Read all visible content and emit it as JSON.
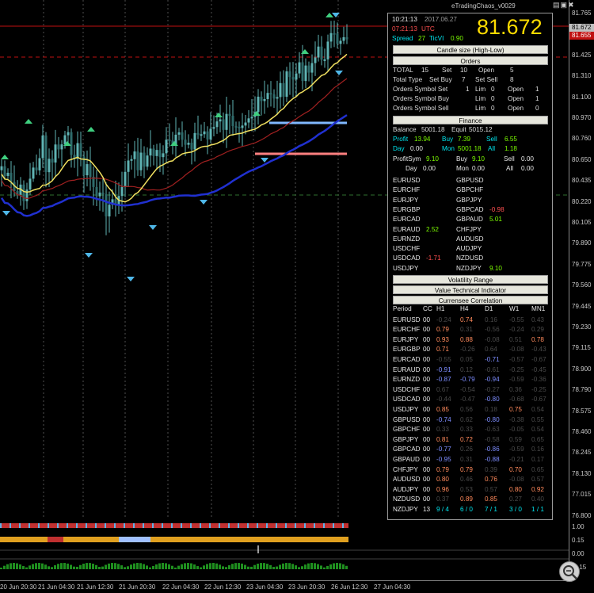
{
  "window": {
    "title": "eTradingChaos_v0029",
    "controls": "▤▣✖"
  },
  "price_axis": {
    "labels": [
      "81.765",
      "81.650",
      "81.425",
      "81.310",
      "81.100",
      "80.970",
      "80.760",
      "80.650",
      "80.435",
      "80.220",
      "80.105",
      "79.890",
      "79.775",
      "79.560",
      "79.445",
      "79.230",
      "79.115",
      "78.900",
      "78.790",
      "78.575",
      "78.460",
      "78.245",
      "78.130",
      "77.015",
      "76.800",
      "1.00",
      "0.15",
      "0.00",
      "-0.15"
    ],
    "current_bid": "81.672",
    "current_ask": "81.655"
  },
  "time_axis": {
    "labels": [
      "20 Jun 20:30",
      "21 Jun 04:30",
      "21 Jun 12:30",
      "21 Jun 20:30",
      "22 Jun 04:30",
      "22 Jun 12:30",
      "23 Jun 04:30",
      "23 Jun 20:30",
      "26 Jun 12:30",
      "27 Jun 04:30"
    ]
  },
  "panel": {
    "local_time": "10:21:13",
    "date": "2017.06.27",
    "utc_time": "07:21:13",
    "utc_label": "UTC",
    "spread_label": "Spread",
    "spread_value": "27",
    "ticvi_label": "TicVI",
    "ticvi_value": "0.90",
    "big_price": "81.672",
    "btn_candle": "Candle size (High-Low)",
    "btn_orders": "Orders",
    "btn_finance": "Finance",
    "btn_volatility": "Volatility Range",
    "btn_value_tech": "Value Technical Indicator",
    "btn_correlation": "Currensee Correlation",
    "orders": {
      "total_label": "TOTAL",
      "total": "15",
      "set_label": "Set",
      "set": "10",
      "open_label": "Open",
      "open": "5",
      "tt_label": "Total Type",
      "setbuy_label": "Set Buy",
      "setbuy": "7",
      "setsell_label": "Set Sell",
      "setsell": "8",
      "oss_label": "Orders Symbol Set",
      "oss_val": "1",
      "lim_label": "Lim",
      "oss_lim": "0",
      "oss_open": "1",
      "osb_label": "Orders Symbol Buy",
      "osb_lim": "0",
      "osb_open": "1",
      "osl_label": "Orders Symbol Sell",
      "osl_lim": "0",
      "osl_open": "0"
    },
    "finance": {
      "balance_label": "Balance",
      "balance": "5001.18",
      "equity_label": "Equit",
      "equity": "5015.12",
      "profit_label": "Profit",
      "profit": "13.94",
      "buy_label": "Buy",
      "buy": "7.39",
      "sell_label": "Sell",
      "sell": "6.55",
      "day_label": "Day",
      "day": "0.00",
      "mon_label": "Mon",
      "mon": "5001.18",
      "all_label": "All",
      "all": "1.18",
      "ps_label": "ProfitSym",
      "ps": "9.10",
      "ps_buy": "9.10",
      "ps_sell": "0.00",
      "ps_day": "0.00",
      "ps_mon": "0.00",
      "ps_all": "0.00"
    },
    "pairs": [
      [
        "EURUSD",
        ""
      ],
      [
        "GBPUSD",
        ""
      ],
      [
        "EURCHF",
        ""
      ],
      [
        "GBPCHF",
        ""
      ],
      [
        "EURJPY",
        ""
      ],
      [
        "GBPJPY",
        ""
      ],
      [
        "EURGBP",
        ""
      ],
      [
        "GBPCAD",
        "-0.98"
      ],
      [
        "EURCAD",
        ""
      ],
      [
        "GBPAUD",
        "5.01"
      ],
      [
        "EURAUD",
        "2.52"
      ],
      [
        "CHFJPY",
        ""
      ],
      [
        "EURNZD",
        ""
      ],
      [
        "AUDUSD",
        ""
      ],
      [
        "USDCHF",
        ""
      ],
      [
        "AUDJPY",
        ""
      ],
      [
        "USDCAD",
        "-1.71"
      ],
      [
        "NZDUSD",
        ""
      ],
      [
        "USDJPY",
        ""
      ],
      [
        "NZDJPY",
        "9.10"
      ]
    ],
    "corr_header": [
      "Period",
      "CC",
      "H1",
      "H4",
      "D1",
      "W1",
      "MN1"
    ],
    "corr_rows": [
      [
        "EURUSD",
        "00",
        "-0.24",
        "0.74",
        "0.16",
        "-0.55",
        "0.43"
      ],
      [
        "EURCHF",
        "00",
        "0.79",
        "0.31",
        "-0.56",
        "-0.24",
        "0.29"
      ],
      [
        "EURJPY",
        "00",
        "0.93",
        "0.88",
        "-0.08",
        "0.51",
        "0.78"
      ],
      [
        "EURGBP",
        "00",
        "0.71",
        "-0.26",
        "0.64",
        "-0.08",
        "-0.43"
      ],
      [
        "EURCAD",
        "00",
        "-0.55",
        "0.05",
        "-0.71",
        "-0.57",
        "-0.67"
      ],
      [
        "EURAUD",
        "00",
        "-0.91",
        "0.12",
        "-0.61",
        "-0.25",
        "-0.45"
      ],
      [
        "EURNZD",
        "00",
        "-0.87",
        "-0.79",
        "-0.94",
        "-0.59",
        "-0.36"
      ],
      [
        "USDCHF",
        "00",
        "0.67",
        "-0.54",
        "-0.27",
        "0.36",
        "-0.25"
      ],
      [
        "USDCAD",
        "00",
        "-0.44",
        "-0.47",
        "-0.80",
        "-0.68",
        "-0.67"
      ],
      [
        "USDJPY",
        "00",
        "0.85",
        "0.56",
        "0.18",
        "0.75",
        "0.54"
      ],
      [
        "GBPUSD",
        "00",
        "-0.74",
        "0.62",
        "-0.80",
        "-0.38",
        "0.55"
      ],
      [
        "GBPCHF",
        "00",
        "0.33",
        "0.33",
        "-0.63",
        "-0.05",
        "0.54"
      ],
      [
        "GBPJPY",
        "00",
        "0.81",
        "0.72",
        "-0.58",
        "0.59",
        "0.65"
      ],
      [
        "GBPCAD",
        "00",
        "-0.77",
        "0.26",
        "-0.86",
        "-0.59",
        "0.16"
      ],
      [
        "GBPAUD",
        "00",
        "-0.95",
        "0.31",
        "-0.88",
        "-0.21",
        "0.17"
      ],
      [
        "CHFJPY",
        "00",
        "0.79",
        "0.79",
        "0.39",
        "0.70",
        "0.65"
      ],
      [
        "AUDUSD",
        "00",
        "0.80",
        "0.46",
        "0.76",
        "-0.08",
        "0.57"
      ],
      [
        "AUDJPY",
        "00",
        "0.96",
        "0.53",
        "0.57",
        "0.80",
        "0.92"
      ],
      [
        "NZDUSD",
        "00",
        "0.37",
        "0.89",
        "0.85",
        "0.27",
        "0.40"
      ],
      [
        "NZDJPY",
        "13",
        "9 / 4",
        "6 / 0",
        "7 / 1",
        "3 / 0",
        "1 / 1"
      ]
    ]
  },
  "colors": {
    "background": "#000000",
    "candle": "#5fb3b3",
    "ma_yellow": "#f0e060",
    "ma_red": "#c03030",
    "ma_blue": "#2030d0",
    "level_blue": "#80b8ff",
    "level_red": "#ff8080"
  }
}
